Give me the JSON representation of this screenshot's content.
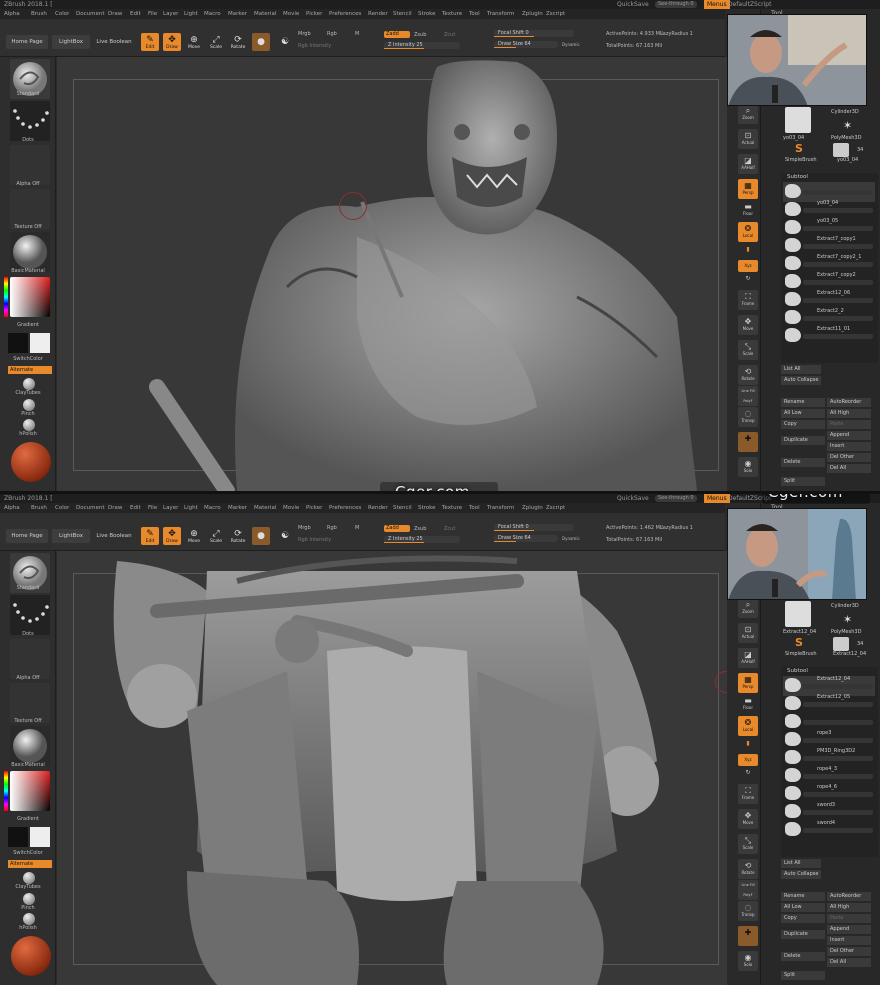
{
  "app": {
    "title": "ZBrush 2018.1 [",
    "quicksave": "QuickSave",
    "menus_label": "Menus",
    "defaultscript": "DefaultZScript",
    "tool_header": "Tool"
  },
  "menubar": [
    "Alpha",
    "Brush",
    "Color",
    "Document",
    "Draw",
    "Edit",
    "File",
    "Layer",
    "Light",
    "Macro",
    "Marker",
    "Material",
    "Movie",
    "Picker",
    "Preferences",
    "Render",
    "Stencil",
    "Stroke",
    "Texture",
    "Tool",
    "Transform",
    "Zplugin",
    "Zscript"
  ],
  "toolbar": {
    "home": "Home Page",
    "lightbox": "LightBox",
    "live_boolean": "Live Boolean",
    "edit": "Edit",
    "draw": "Draw",
    "move": "Move",
    "scale": "Scale",
    "rotate": "Rotate",
    "mrgb": "Mrgb",
    "rgb": "Rgb",
    "m": "M",
    "rgb_intensity": "Rgb Intensity",
    "zadd": "Zadd",
    "zsub": "Zsub",
    "zcut": "Zcut",
    "z_intensity": "Z Intensity 25",
    "focal_shift": "Focal Shift 0",
    "draw_size": "Draw Size 64",
    "dynamic": "Dynamic"
  },
  "panels": [
    {
      "see_through": "See-through 0",
      "active_points": "ActivePoints: 4.933 Mil",
      "total_points": "TotalPoints: 67.163 Mil",
      "lazy_radius": "LazyRadius 1"
    },
    {
      "see_through": "See-through 0",
      "active_points": "ActivePoints: 1.462 Mil",
      "total_points": "TotalPoints: 67.163 Mil",
      "lazy_radius": "LazyRadius 1"
    }
  ],
  "left_shelf": {
    "standard": "Standard",
    "dots": "Dots",
    "alpha_off": "Alpha Off",
    "texture_off": "Texture Off",
    "material": "BasicMaterial",
    "gradient": "Gradient",
    "switch_color": "SwitchColor",
    "alternate": "Alternate",
    "claytubes": "ClayTubes",
    "pinch": "Pinch",
    "hpolish": "hPolish"
  },
  "right_shelf": [
    "Zoom",
    "Actual",
    "AAHalf",
    "Persp",
    "Floor",
    "Local",
    "Xyz",
    "",
    "Frame",
    "Move",
    "Scale",
    "Rotate",
    "Line Fill PolyF",
    "Transp",
    "",
    "Solo"
  ],
  "tool_panel": [
    {
      "thumbs": [
        "yo03_04",
        "Cylinder3D",
        "PolyMesh3D",
        "SimpleBrush",
        "yo03_04"
      ],
      "count": "34"
    },
    {
      "thumbs": [
        "Extract12_04",
        "Cylinder3D",
        "PolyMesh3D",
        "SimpleBrush",
        "Extract12_04"
      ],
      "count": "34"
    }
  ],
  "subtool_header": "Subtool",
  "subtools": [
    [
      "yo03_04",
      "yo03_05",
      "Extract7_copy1",
      "Extract7_copy2_1",
      "Extract7_copy2",
      "Extract12_06",
      "Extract2_2",
      "Extract11_01"
    ],
    [
      "Extract12_04",
      "Extract12_05",
      "rope3",
      "PM3D_Ring3D2",
      "rope4_3",
      "rope4_6",
      "sword3",
      "sword4"
    ]
  ],
  "tool_buttons": {
    "list_all": "List All",
    "auto_collapse": "Auto Collapse",
    "rename": "Rename",
    "autoreorder": "AutoReorder",
    "all_low": "All Low",
    "all_high": "All High",
    "copy": "Copy",
    "paste": "Paste",
    "duplicate": "Duplicate",
    "append": "Append",
    "insert": "Insert",
    "delete": "Delete",
    "del_other": "Del Other",
    "del_all": "Del All",
    "split": "Split"
  },
  "watermark": "Cger.com"
}
